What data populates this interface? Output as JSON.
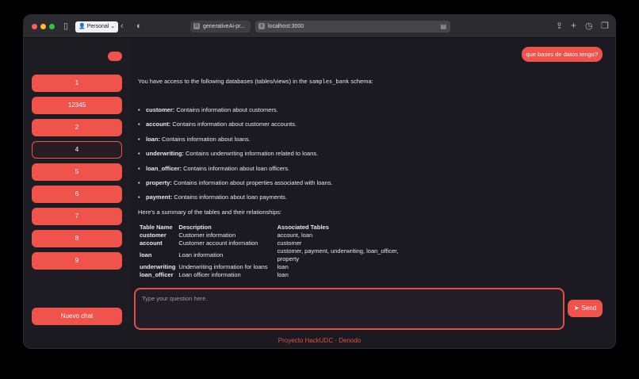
{
  "browser": {
    "profile_label": "Personal",
    "tabs": [
      {
        "label": "generativeAi-pr...",
        "favicon": "G"
      },
      {
        "label": "localhost:3000",
        "favicon": "x"
      }
    ]
  },
  "sidebar": {
    "chats": [
      "1",
      "12345",
      "2",
      "4",
      "5",
      "6",
      "7",
      "8",
      "9"
    ],
    "active_chat": "4",
    "new_chat_label": "Nuevo chat"
  },
  "conversation": {
    "user_message": "que bases de datos tengo?",
    "intro_before": "You have access to the following databases (tables/views) in the ",
    "intro_schema": "samples_bank",
    "intro_after": " schema:",
    "databases": [
      {
        "name": "customer:",
        "desc": " Contains information about customers."
      },
      {
        "name": "account:",
        "desc": " Contains information about customer accounts."
      },
      {
        "name": "loan:",
        "desc": " Contains information about loans."
      },
      {
        "name": "underwriting:",
        "desc": " Contains underwriting information related to loans."
      },
      {
        "name": "loan_officer:",
        "desc": " Contains information about loan officers."
      },
      {
        "name": "property:",
        "desc": " Contains information about properties associated with loans."
      },
      {
        "name": "payment:",
        "desc": " Contains information about loan payments."
      }
    ],
    "summary_text": "Here's a summary of the tables and their relationships:",
    "table": {
      "headers": [
        "Table Name",
        "Description",
        "Associated Tables"
      ],
      "rows": [
        [
          "customer",
          "Customer information",
          "account, loan"
        ],
        [
          "account",
          "Customer account information",
          "customer"
        ],
        [
          "loan",
          "Loan information",
          "customer, payment, underwriting, loan_officer, property"
        ],
        [
          "underwriting",
          "Underwriting information for loans",
          "loan"
        ],
        [
          "loan_officer",
          "Loan officer information",
          "loan"
        ]
      ]
    }
  },
  "input": {
    "placeholder": "Type your question here.",
    "send_label": "Send"
  },
  "footer": "Proyecto HackUDC - Denodo",
  "colors": {
    "accent": "#f0524c",
    "background": "#1b1a22"
  }
}
